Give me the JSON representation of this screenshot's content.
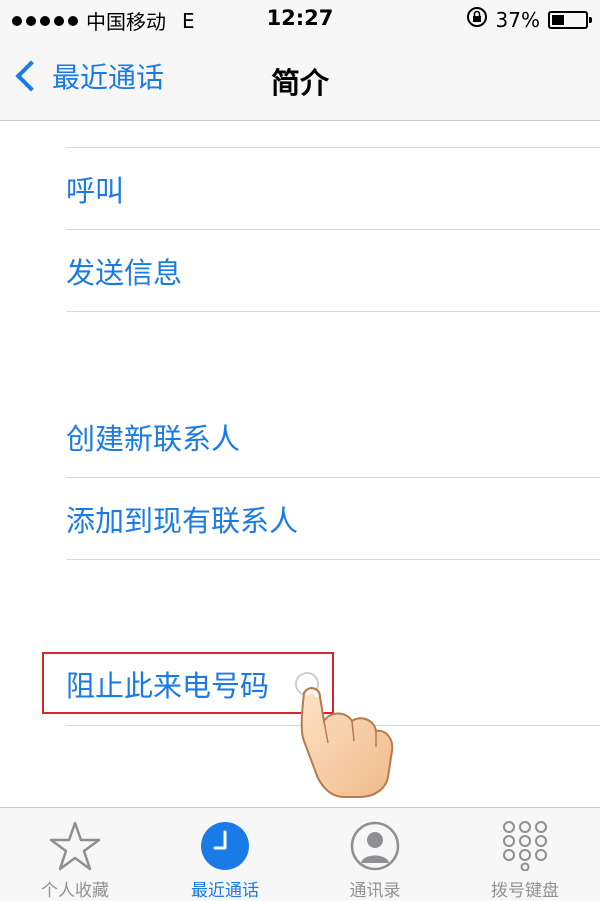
{
  "status_bar": {
    "carrier": "中国移动",
    "network": "E",
    "time": "12:27",
    "battery": "37%",
    "battery_level": 0.37
  },
  "nav": {
    "back_label": "最近通话",
    "title": "简介"
  },
  "actions": {
    "call": "呼叫",
    "send_message": "发送信息",
    "create_contact": "创建新联系人",
    "add_to_existing": "添加到现有联系人",
    "block_caller": "阻止此来电号码"
  },
  "tabs": [
    {
      "label": "个人收藏",
      "icon": "star-icon",
      "active": false
    },
    {
      "label": "最近通话",
      "icon": "clock-icon",
      "active": true
    },
    {
      "label": "通讯录",
      "icon": "contact-icon",
      "active": false
    },
    {
      "label": "拨号键盘",
      "icon": "keypad-icon",
      "active": false
    }
  ],
  "colors": {
    "accent": "#1a7be6",
    "highlight": "#d9262c",
    "inactive": "#929292"
  }
}
